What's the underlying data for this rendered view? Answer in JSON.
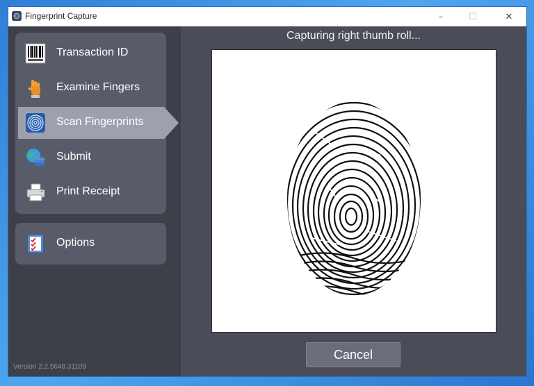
{
  "window": {
    "title": "Fingerprint Capture",
    "controls": {
      "minimize": "–",
      "maximize": "☐",
      "close": "✕"
    }
  },
  "sidebar": {
    "items": [
      {
        "label": "Transaction ID",
        "icon": "barcode-icon",
        "active": false
      },
      {
        "label": "Examine Fingers",
        "icon": "hand-icon",
        "active": false
      },
      {
        "label": "Scan Fingerprints",
        "icon": "fingerprint-icon",
        "active": true
      },
      {
        "label": "Submit",
        "icon": "globe-submit-icon",
        "active": false
      },
      {
        "label": "Print Receipt",
        "icon": "printer-icon",
        "active": false
      }
    ],
    "options": {
      "label": "Options",
      "icon": "checklist-icon"
    },
    "version": "Version 2.2.5648.31109"
  },
  "main": {
    "caption": "Capturing right thumb roll...",
    "cancel_label": "Cancel"
  },
  "colors": {
    "desktop": "#3b8ee0",
    "window_bg": "#4a4d57",
    "sidebar_bg": "#3d4049",
    "panel_bg": "#585c68",
    "selected_bg": "#9ea1ad",
    "button_bg": "#6a6e7b"
  }
}
